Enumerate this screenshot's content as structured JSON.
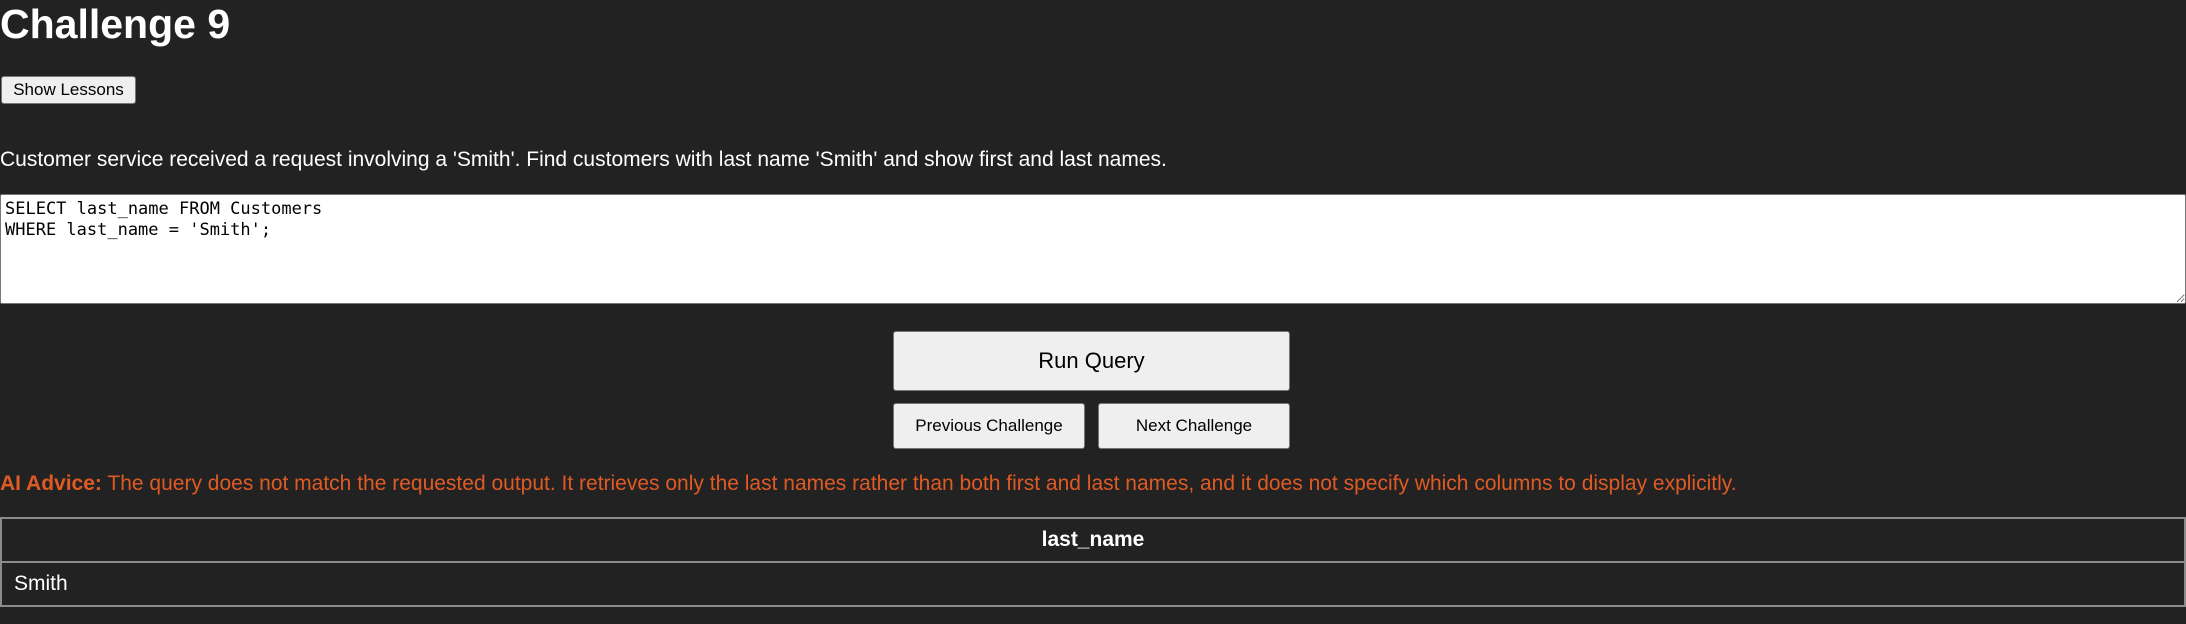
{
  "challenge": {
    "title": "Challenge 9",
    "show_lessons_label": "Show Lessons",
    "prompt": "Customer service received a request involving a 'Smith'. Find customers with last name 'Smith' and show first and last names."
  },
  "editor": {
    "query": "SELECT last_name FROM Customers\nWHERE last_name = 'Smith';"
  },
  "actions": {
    "run_label": "Run Query",
    "previous_label": "Previous Challenge",
    "next_label": "Next Challenge"
  },
  "advice": {
    "label": "AI Advice:",
    "text": "The query does not match the requested output. It retrieves only the last names rather than both first and last names, and it does not specify which columns to display explicitly.",
    "color": "#e05a24"
  },
  "results": {
    "columns": [
      "last_name"
    ],
    "rows": [
      [
        "Smith"
      ]
    ]
  }
}
